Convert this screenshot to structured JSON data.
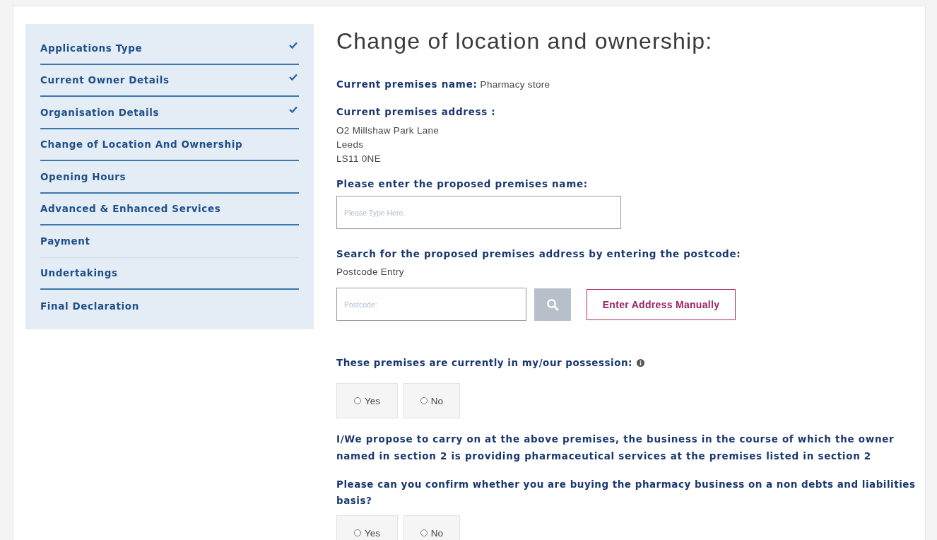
{
  "sidebar": {
    "items": [
      {
        "label": "Applications Type",
        "completed": true,
        "divider": true,
        "faint": false
      },
      {
        "label": "Current Owner Details",
        "completed": true,
        "divider": true,
        "faint": false
      },
      {
        "label": "Organisation Details",
        "completed": true,
        "divider": true,
        "faint": false
      },
      {
        "label": "Change of Location And Ownership",
        "completed": false,
        "divider": true,
        "faint": false
      },
      {
        "label": "Opening Hours",
        "completed": false,
        "divider": true,
        "faint": false
      },
      {
        "label": "Advanced & Enhanced Services",
        "completed": false,
        "divider": true,
        "faint": false
      },
      {
        "label": "Payment",
        "completed": false,
        "divider": true,
        "faint": true
      },
      {
        "label": "Undertakings",
        "completed": false,
        "divider": true,
        "faint": false
      },
      {
        "label": "Final Declaration",
        "completed": false,
        "divider": false
      }
    ]
  },
  "main": {
    "title": "Change of location and ownership:",
    "current_name": {
      "label": "Current premises name:",
      "value": "Pharmacy store"
    },
    "current_address": {
      "label": "Current premises address :",
      "lines": [
        "O2 Millshaw Park Lane",
        "Leeds",
        "LS11 0NE"
      ]
    },
    "proposed_name": {
      "label": "Please enter the proposed premises name:",
      "placeholder": "Please Type Here."
    },
    "postcode_search": {
      "label": "Search for the proposed premises address by entering the postcode:",
      "sublabel": "Postcode Entry",
      "placeholder": "Postcode:",
      "manual_button": "Enter Address Manually"
    },
    "questions": [
      {
        "kind": "radio",
        "label": "These premises are currently in my/our possession:",
        "info": true,
        "options": [
          {
            "label": "Yes",
            "selected": false
          },
          {
            "label": "No",
            "selected": false
          }
        ]
      },
      {
        "kind": "statement",
        "label": "I/We propose to carry on at the above premises, the business in the course of which the owner named in section 2 is providing pharmaceutical services at the premises listed in section 2"
      },
      {
        "kind": "radio",
        "label": "Please can you confirm whether you are buying the pharmacy business on a non debts and liabilities basis?",
        "info": false,
        "options": [
          {
            "label": "Yes",
            "selected": false
          },
          {
            "label": "No",
            "selected": false
          }
        ]
      }
    ]
  }
}
